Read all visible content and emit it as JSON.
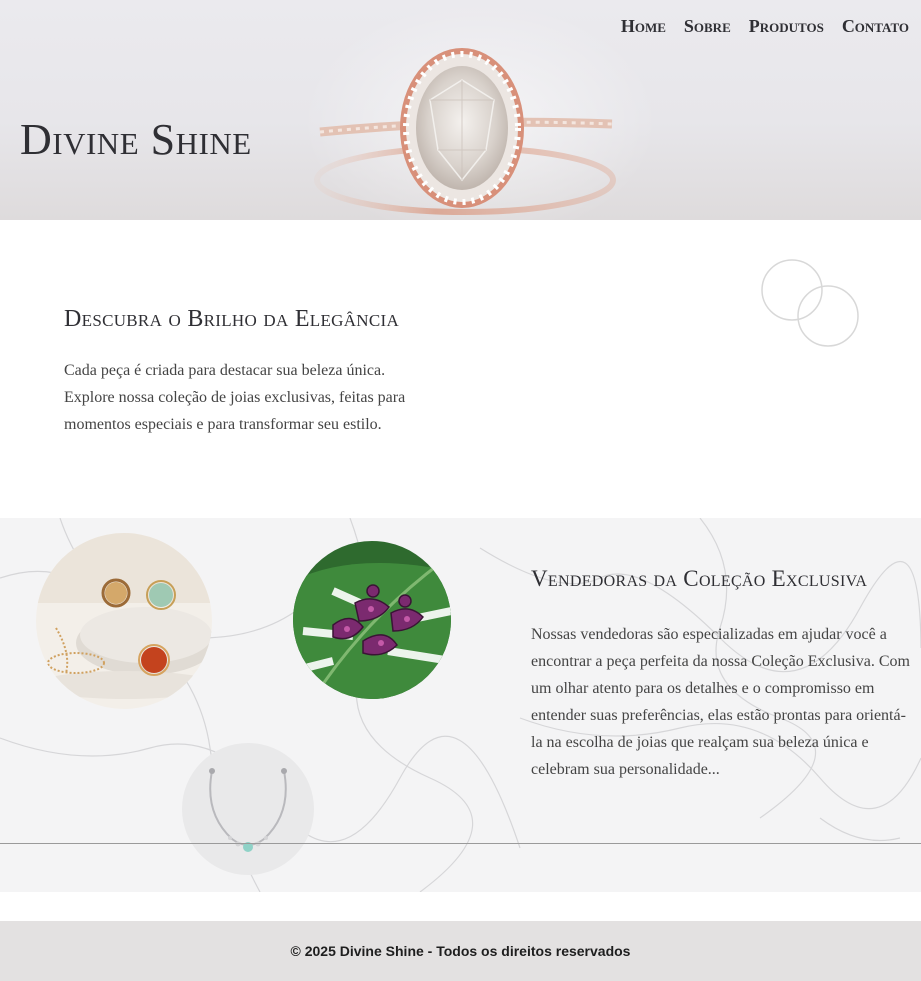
{
  "header": {
    "brand": "Divine Shine",
    "nav": [
      "Home",
      "Sobre",
      "Produtos",
      "Contato"
    ]
  },
  "intro": {
    "title": "Descubra o Brilho da Elegância",
    "text": "Cada peça é criada para destacar sua beleza única. Explore nossa coleção de joias exclusivas, feitas para momentos especiais e para transformar seu estilo."
  },
  "collection": {
    "title": "Vendedoras da Coleção Exclusiva",
    "text": "Nossas vendedoras são especializadas em ajudar você a encontrar a peça perfeita da nossa Coleção Exclusiva. Com um olhar atento para os detalhes e o compromisso em entender suas preferências, elas estão prontas para orientá-la na escolha de joias que realçam sua beleza única e celebram sua personalidade..."
  },
  "footer": {
    "copyright": "© 2025 Divine Shine - Todos os direitos reservados"
  }
}
